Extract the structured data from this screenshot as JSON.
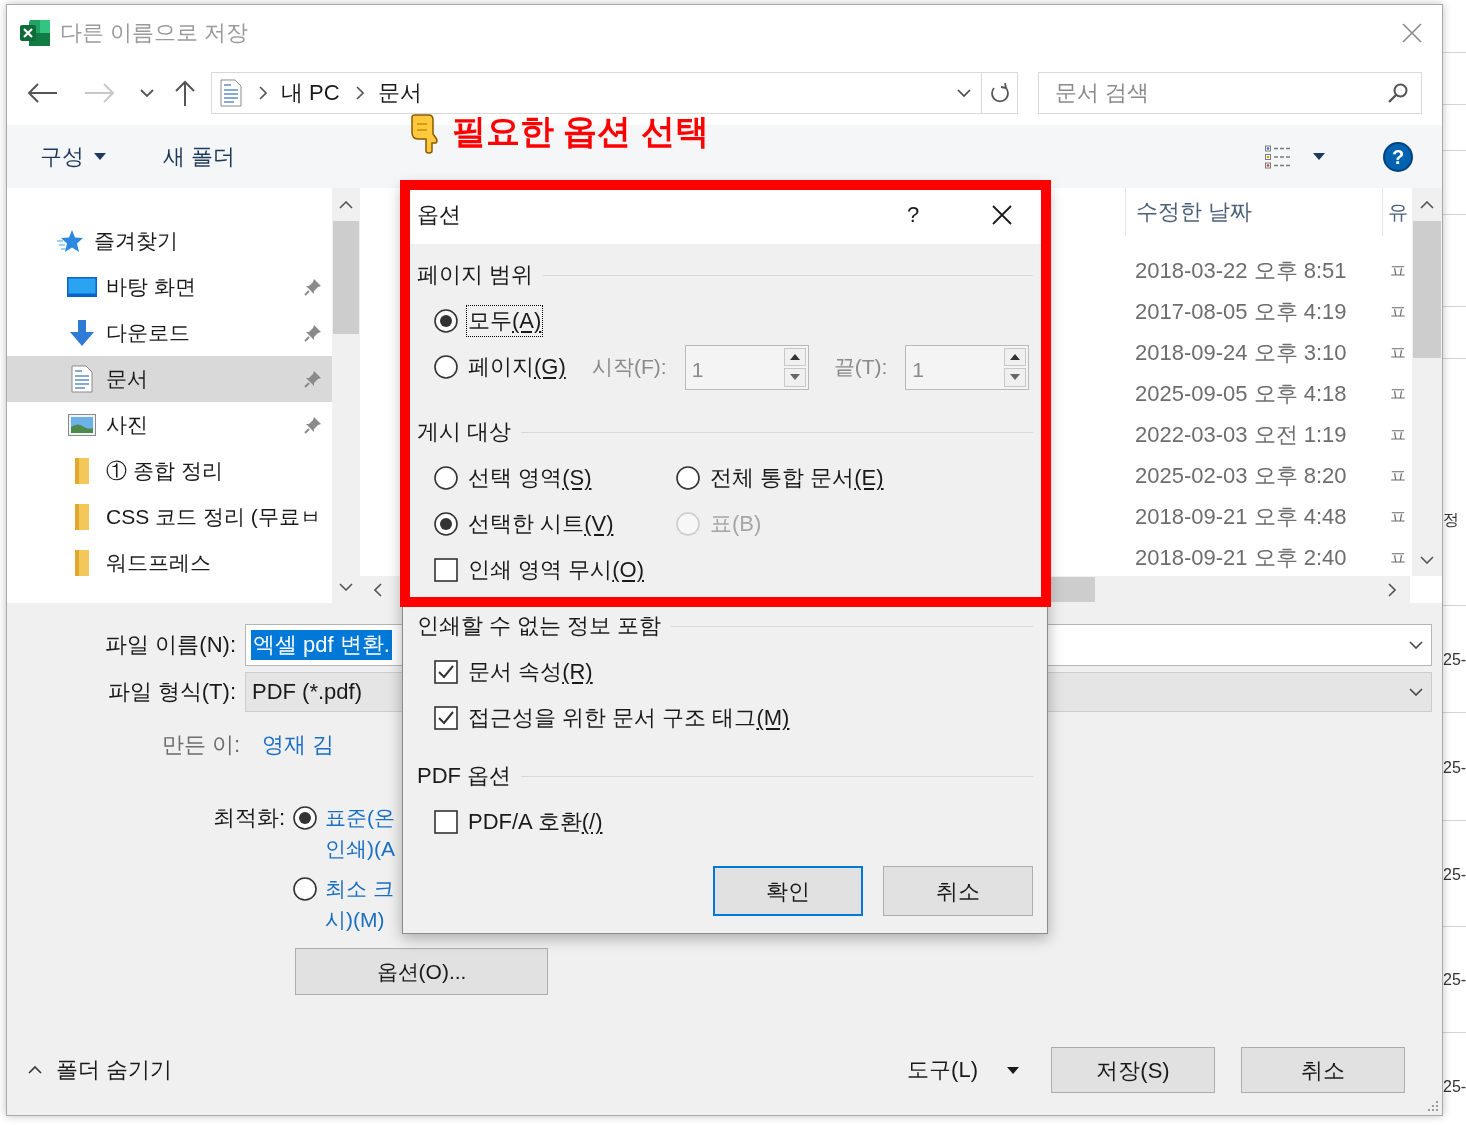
{
  "window": {
    "title": "다른 이름으로 저장"
  },
  "navigation": {
    "buttons": [
      {
        "kind": "back",
        "disabled": false
      },
      {
        "kind": "forward",
        "disabled": true
      },
      {
        "kind": "recent",
        "disabled": false
      },
      {
        "kind": "up",
        "disabled": false
      }
    ],
    "path": [
      "내 PC",
      "문서"
    ],
    "search": {
      "placeholder": "문서 검색"
    }
  },
  "toolbar": {
    "organize": "구성",
    "new_folder": "새 폴더",
    "help": "?"
  },
  "annotation": {
    "text": "필요한 옵션 선택",
    "frame": true
  },
  "sidebar": {
    "items": [
      {
        "label": "즐겨찾기",
        "kind": "favorites",
        "selected": false,
        "pinned": false,
        "children": [
          {
            "label": "바탕 화면",
            "kind": "desktop",
            "selected": false,
            "pinned": true
          },
          {
            "label": "다운로드",
            "kind": "downloads",
            "selected": false,
            "pinned": true
          },
          {
            "label": "문서",
            "kind": "documents",
            "selected": true,
            "pinned": true
          },
          {
            "label": "사진",
            "kind": "pictures",
            "selected": false,
            "pinned": true
          },
          {
            "label": "① 종합 정리",
            "kind": "folder",
            "selected": false,
            "pinned": false
          },
          {
            "label": "CSS 코드 정리 (무료ㅂ",
            "kind": "folder",
            "selected": false,
            "pinned": false
          },
          {
            "label": "워드프레스",
            "kind": "folder",
            "selected": false,
            "pinned": false
          }
        ]
      }
    ]
  },
  "file_list": {
    "columns": [
      "수정한 날짜",
      "유"
    ],
    "rows": [
      {
        "modified": "2018-03-22 오후 8:51",
        "column_2": "ㅍ"
      },
      {
        "modified": "2017-08-05 오후 4:19",
        "column_2": "ㅍ"
      },
      {
        "modified": "2018-09-24 오후 3:10",
        "column_2": "ㅍ"
      },
      {
        "modified": "2025-09-05 오후 4:18",
        "column_2": "ㅍ"
      },
      {
        "modified": "2022-03-03 오전 1:19",
        "column_2": "ㅍ"
      },
      {
        "modified": "2025-02-03 오후 8:20",
        "column_2": "ㅍ"
      },
      {
        "modified": "2018-09-21 오후 4:48",
        "column_2": "ㅍ"
      },
      {
        "modified": "2018-09-21 오후 2:40",
        "column_2": "ㅍ"
      }
    ]
  },
  "form": {
    "file_name": {
      "label": "파일 이름(N):",
      "value": "엑셀 pdf 변환.",
      "selected": true
    },
    "file_type": {
      "label": "파일 형식(T):",
      "value": "PDF (*.pdf)"
    },
    "authors": {
      "label": "만든 이:",
      "value": "영재 김"
    },
    "optimize": {
      "label": "최적화:",
      "options": [
        {
          "lines": [
            "표준(온",
            "인쇄)(A"
          ],
          "selected": true
        },
        {
          "lines": [
            "최소 크",
            "시)(M)"
          ],
          "selected": false
        }
      ]
    },
    "options_button": "옵션(O)..."
  },
  "footer": {
    "hide_folders": "폴더 숨기기",
    "tools": "도구(L)",
    "buttons": [
      {
        "label": "저장(S)"
      },
      {
        "label": "취소"
      }
    ]
  },
  "options_dialog": {
    "title": "옵션",
    "help": "?",
    "groups": [
      {
        "title": "페이지 범위",
        "rows": [
          [
            {
              "kind": "radio",
              "label": "모두",
              "key": "(A)",
              "selected": true,
              "disabled": false,
              "focused": true
            }
          ],
          [
            {
              "kind": "radio",
              "label": "페이지",
              "key": "(G)",
              "selected": false,
              "disabled": false,
              "focused": false
            },
            {
              "kind": "spin",
              "label": "시작(F):",
              "value": "1",
              "disabled": true
            },
            {
              "kind": "spin",
              "label": "끝(T):",
              "value": "1",
              "disabled": true
            }
          ]
        ]
      },
      {
        "title": "게시 대상",
        "rows": [
          [
            {
              "kind": "radio",
              "label": "선택 영역",
              "key": "(S)",
              "selected": false,
              "disabled": false,
              "focused": false
            },
            {
              "kind": "radio",
              "label": "전체 통합 문서",
              "key": "(E)",
              "selected": false,
              "disabled": false,
              "focused": false
            }
          ],
          [
            {
              "kind": "radio",
              "label": "선택한 시트",
              "key": "(V)",
              "selected": true,
              "disabled": false,
              "focused": false
            },
            {
              "kind": "radio",
              "label": "표",
              "key": "(B)",
              "selected": false,
              "disabled": true,
              "focused": false
            }
          ],
          [
            {
              "kind": "checkbox",
              "label": "인쇄 영역 무시",
              "key": "(O)",
              "checked": false,
              "disabled": false,
              "focused": false
            }
          ]
        ]
      },
      {
        "title": "인쇄할 수 없는 정보 포함",
        "rows": [
          [
            {
              "kind": "checkbox",
              "label": "문서 속성",
              "key": "(R)",
              "checked": true,
              "disabled": false,
              "focused": false
            }
          ],
          [
            {
              "kind": "checkbox",
              "label": "접근성을 위한 문서 구조 태그",
              "key": "(M)",
              "checked": true,
              "disabled": false,
              "focused": false
            }
          ]
        ]
      },
      {
        "title": "PDF 옵션",
        "rows": [
          [
            {
              "kind": "checkbox",
              "label": "PDF/A 호환",
              "key": "(/)",
              "checked": false,
              "disabled": false,
              "focused": false
            }
          ]
        ]
      }
    ],
    "buttons": [
      {
        "label": "확인",
        "default": true
      },
      {
        "label": "취소",
        "default": false
      }
    ]
  },
  "background": {
    "fragments": [
      "정",
      "25-",
      "25-",
      "25-",
      "25-",
      "25-"
    ]
  }
}
